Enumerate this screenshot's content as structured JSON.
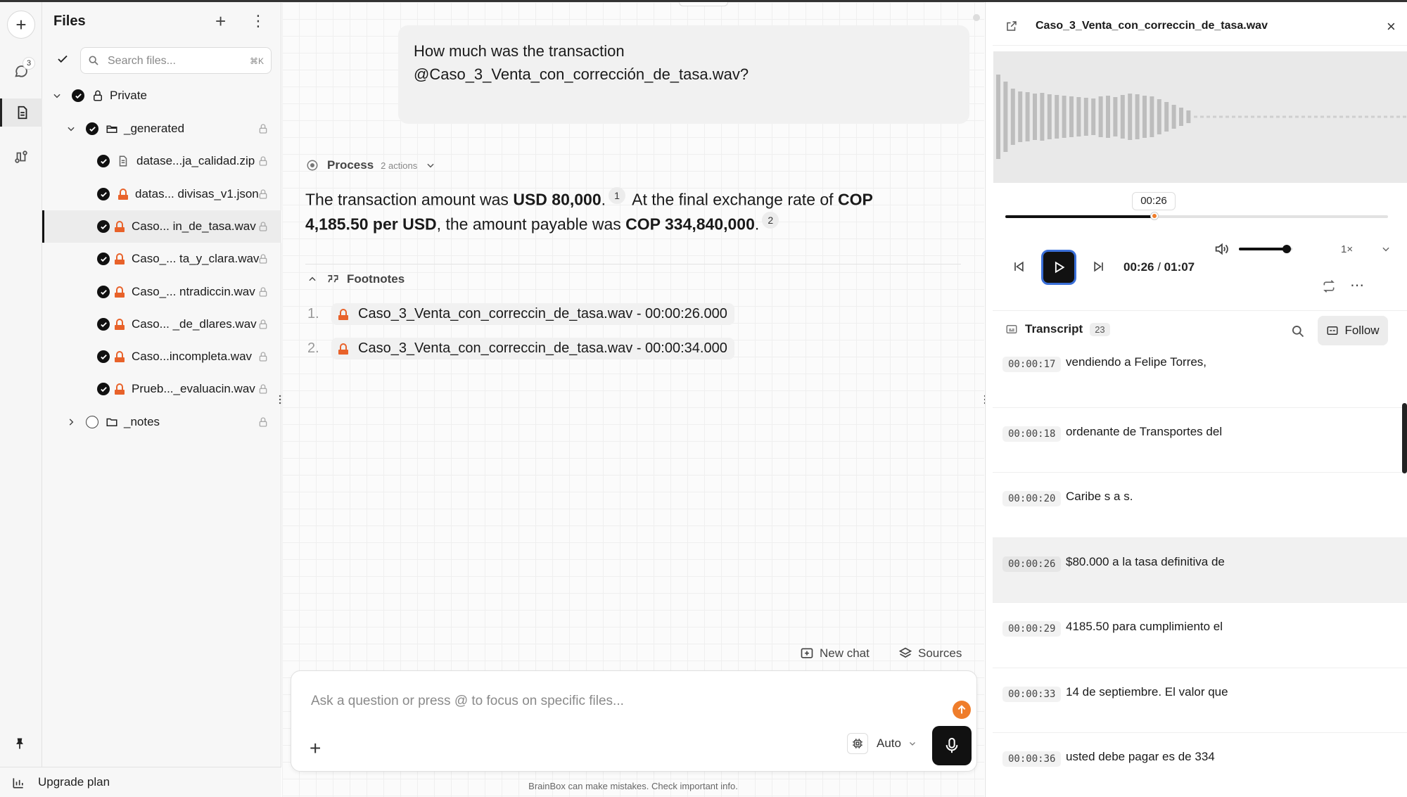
{
  "rail": {
    "chat_badge": "3"
  },
  "files": {
    "title": "Files",
    "search_placeholder": "Search files...",
    "search_shortcut": "⌘K",
    "tree": [
      {
        "label": "Private"
      },
      {
        "label": "_generated"
      },
      {
        "label": "datase...ja_calidad.zip"
      },
      {
        "label": "datas... divisas_v1.json"
      },
      {
        "label": "Caso... in_de_tasa.wav"
      },
      {
        "label": "Caso_... ta_y_clara.wav"
      },
      {
        "label": "Caso_... ntradiccin.wav"
      },
      {
        "label": "Caso... _de_dlares.wav"
      },
      {
        "label": "Caso...incompleta.wav"
      },
      {
        "label": "Prueb..._evaluacin.wav"
      },
      {
        "label": "_notes"
      }
    ],
    "upgrade_label": "Upgrade plan"
  },
  "chat": {
    "question_line1": "How much was the transaction",
    "question_line2": "@Caso_3_Venta_con_corrección_de_tasa.wav?",
    "process_label": "Process",
    "process_count": "2 actions",
    "answer": {
      "p1": "The transaction amount was ",
      "b1": "USD 80,000",
      "p2": ".",
      "ref1": "1",
      "p3": " At the final exchange rate of ",
      "b2": "COP 4,185.50 per USD",
      "p4": ", the amount payable was ",
      "b3": "COP 334,840,000",
      "p5": ".",
      "ref2": "2"
    },
    "footnotes_label": "Footnotes",
    "footnotes": [
      {
        "num": "1.",
        "text": "Caso_3_Venta_con_correccin_de_tasa.wav - 00:00:26.000"
      },
      {
        "num": "2.",
        "text": "Caso_3_Venta_con_correccin_de_tasa.wav - 00:00:34.000"
      }
    ],
    "new_chat_label": "New chat",
    "sources_label": "Sources",
    "input_placeholder": "Ask a question or press @ to focus on specific files...",
    "model_label": "Auto",
    "disclaimer": "BrainBox can make mistakes. Check important info."
  },
  "player": {
    "title": "Caso_3_Venta_con_correccin_de_tasa.wav",
    "time_tooltip": "00:26",
    "current_time": "00:26",
    "duration": "01:07",
    "progress": 0.39,
    "volume": 0.9,
    "rate": "1×"
  },
  "transcript": {
    "label": "Transcript",
    "count": "23",
    "follow_label": "Follow",
    "segments": [
      {
        "ts": "00:00:17",
        "text": "vendiendo a Felipe Torres,"
      },
      {
        "ts": "00:00:18",
        "text": "ordenante de Transportes del"
      },
      {
        "ts": "00:00:20",
        "text": "Caribe s a s."
      },
      {
        "ts": "00:00:26",
        "text": "$80.000 a la tasa definitiva de"
      },
      {
        "ts": "00:00:29",
        "text": "4185.50 para cumplimiento el"
      },
      {
        "ts": "00:00:33",
        "text": "14 de septiembre. El valor que"
      },
      {
        "ts": "00:00:36",
        "text": "usted debe pagar es de 334"
      }
    ]
  }
}
